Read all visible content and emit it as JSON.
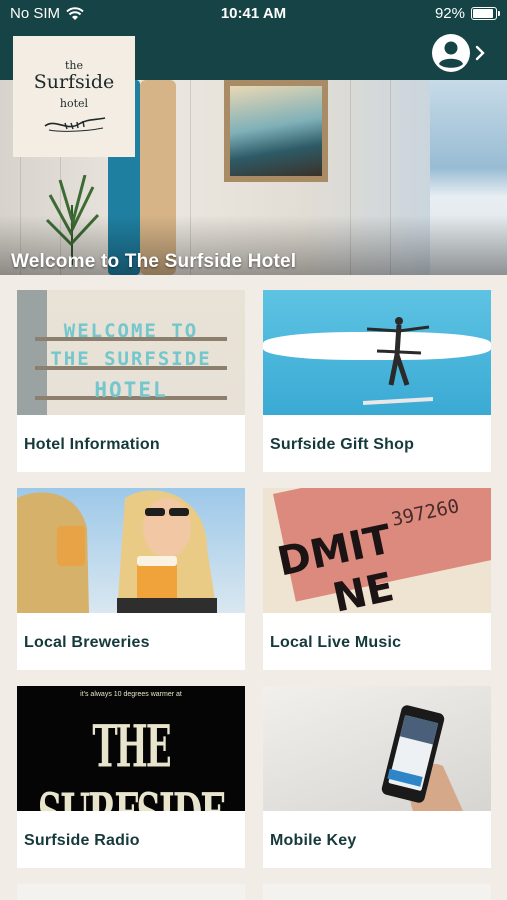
{
  "status_bar": {
    "carrier": "No SIM",
    "time": "10:41 AM",
    "battery_percent": "92%",
    "battery_level": 0.92
  },
  "header": {
    "profile_icon": "account-circle-icon",
    "chevron_icon": "chevron-right-icon",
    "colors": {
      "band": "#164345",
      "accent": "#73c7cd"
    }
  },
  "logo": {
    "the": "the",
    "name": "Surfside",
    "hotel": "hotel"
  },
  "hero": {
    "title": "Welcome to The Surfside Hotel"
  },
  "tiles": [
    {
      "label": "Hotel Information",
      "image_text": [
        "WELCOME TO",
        "THE SURFSIDE",
        "HOTEL"
      ]
    },
    {
      "label": "Surfside Gift Shop"
    },
    {
      "label": "Local Breweries"
    },
    {
      "label": "Local Live Music",
      "image_text": [
        "397260",
        "DMIT",
        "NE"
      ]
    },
    {
      "label": "Surfside Radio",
      "image_text": [
        "it's always 10 degrees warmer at",
        "THE SURFSIDE"
      ]
    },
    {
      "label": "Mobile Key"
    }
  ]
}
